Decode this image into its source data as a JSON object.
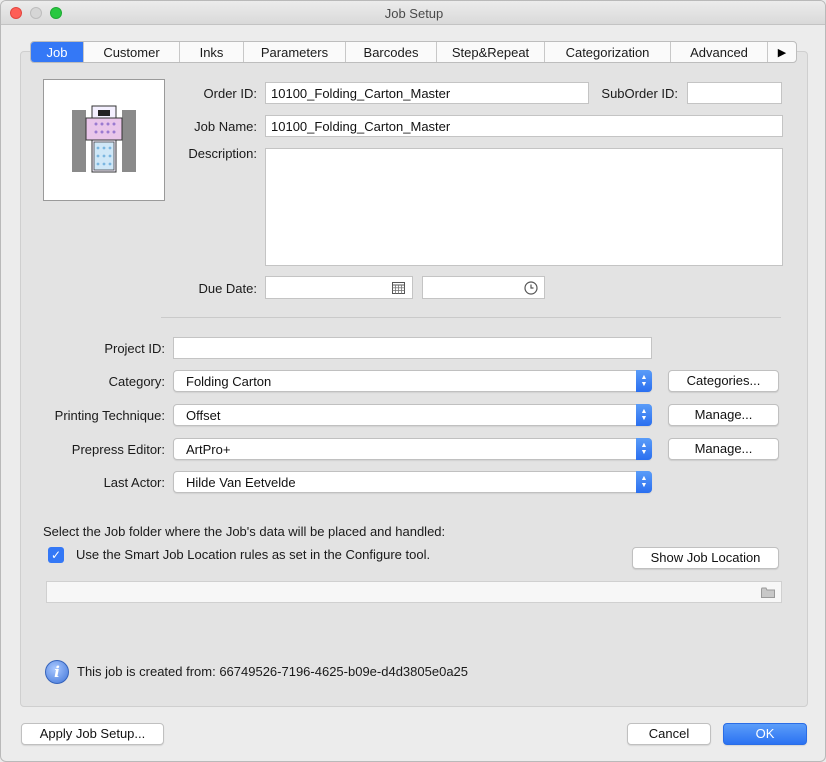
{
  "window": {
    "title": "Job Setup"
  },
  "tabs": [
    {
      "label": "Job"
    },
    {
      "label": "Customer"
    },
    {
      "label": "Inks"
    },
    {
      "label": "Parameters"
    },
    {
      "label": "Barcodes"
    },
    {
      "label": "Step&Repeat"
    },
    {
      "label": "Categorization"
    },
    {
      "label": "Advanced"
    }
  ],
  "tab_overflow_icon": "triangle-right-icon",
  "job": {
    "order_id_label": "Order ID:",
    "order_id_value": "10100_Folding_Carton_Master",
    "suborder_id_label": "SubOrder ID:",
    "suborder_id_value": "",
    "job_name_label": "Job Name:",
    "job_name_value": "10100_Folding_Carton_Master",
    "description_label": "Description:",
    "description_value": "",
    "due_date_label": "Due Date:",
    "due_date_value": "",
    "due_time_value": "",
    "calendar_icon": "calendar-icon",
    "clock_icon": "clock-icon"
  },
  "details": {
    "project_id_label": "Project ID:",
    "project_id_value": "",
    "category_label": "Category:",
    "category_value": "Folding Carton",
    "categories_button": "Categories...",
    "printing_technique_label": "Printing Technique:",
    "printing_technique_value": "Offset",
    "printing_manage_button": "Manage...",
    "prepress_editor_label": "Prepress Editor:",
    "prepress_editor_value": "ArtPro+",
    "prepress_manage_button": "Manage...",
    "last_actor_label": "Last Actor:",
    "last_actor_value": "Hilde Van Eetvelde"
  },
  "location": {
    "prompt": "Select the Job folder where the Job's data will be placed and handled:",
    "smart_rules_label": "Use the Smart Job Location rules as set in the Configure tool.",
    "smart_rules_checked": true,
    "show_location_button": "Show Job Location",
    "path_value": "",
    "folder_icon": "folder-icon"
  },
  "info": {
    "created_from": "This job is created from: 66749526-7196-4625-b09e-d4d3805e0a25"
  },
  "footer": {
    "apply_button": "Apply Job Setup...",
    "cancel_button": "Cancel",
    "ok_button": "OK"
  },
  "colors": {
    "accent": "#3478f6",
    "close": "#fe5f57",
    "minimize": "#febc2e",
    "zoom": "#28c840"
  }
}
